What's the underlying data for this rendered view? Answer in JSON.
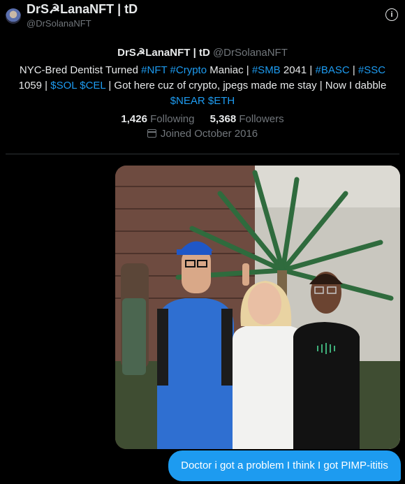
{
  "header": {
    "title": "DrS☭LanaNFT | tD",
    "handle": "@DrSolanaNFT",
    "info_icon": "info-icon",
    "info_glyph": "i"
  },
  "profile": {
    "name": "DrS☭LanaNFT | tD",
    "handle": "@DrSolanaNFT",
    "bio": [
      {
        "text": "NYC-Bred Dentist Turned ",
        "link": false
      },
      {
        "text": "#NFT",
        "link": true
      },
      {
        "text": " ",
        "link": false
      },
      {
        "text": "#Crypto",
        "link": true
      },
      {
        "text": " Maniac | ",
        "link": false
      },
      {
        "text": "#SMB",
        "link": true
      },
      {
        "text": " 2041 | ",
        "link": false
      },
      {
        "text": "#BASC",
        "link": true
      },
      {
        "text": " | ",
        "link": false
      },
      {
        "text": "#SSC",
        "link": true
      },
      {
        "text": " 1059 | ",
        "link": false
      },
      {
        "text": "$SOL",
        "link": true
      },
      {
        "text": " ",
        "link": false
      },
      {
        "text": "$CEL",
        "link": true
      },
      {
        "text": " | Got here cuz of crypto, jpegs made me stay | Now I dabble ",
        "link": false
      },
      {
        "text": "$NEAR",
        "link": true
      },
      {
        "text": " ",
        "link": false
      },
      {
        "text": "$ETH",
        "link": true
      }
    ],
    "following_count": "1,426",
    "following_label": "Following",
    "followers_count": "5,368",
    "followers_label": "Followers",
    "joined": "Joined October 2016"
  },
  "message": {
    "text": "Doctor i got a problem I think I got PIMP-ititis"
  },
  "colors": {
    "background": "#000000",
    "accent": "#1d9bf0",
    "muted": "#71767b"
  }
}
